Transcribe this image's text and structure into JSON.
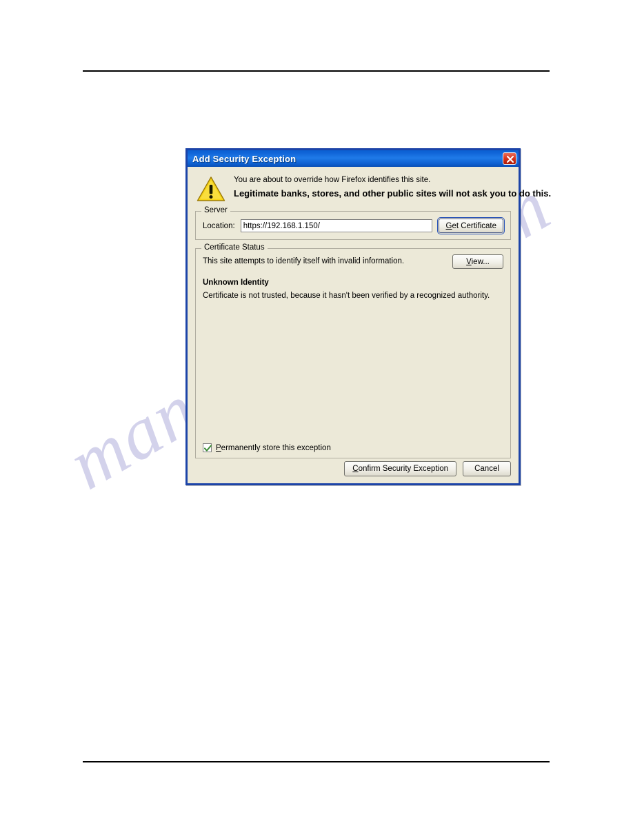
{
  "page": {
    "watermark_text": "manualshive.com",
    "watermark_color": "#b9b8e0",
    "rule_color": "#000000"
  },
  "dialog": {
    "title": "Add Security Exception",
    "titlebar_color": "#1f7ae8",
    "background_color": "#ece9d8",
    "border_color": "#1c44a8",
    "close_button": {
      "icon": "close-icon",
      "color": "#d8341d",
      "label": "Close"
    },
    "warning": {
      "icon": "warning-triangle-icon",
      "icon_color": "#f5cc18",
      "line1": "You are about to override how Firefox identifies this site.",
      "line2": "Legitimate banks, stores, and other public sites will not ask you to do this."
    },
    "server_group": {
      "title": "Server",
      "location_label": "Location:",
      "location_value": "https://192.168.1.150/",
      "location_placeholder": "",
      "get_certificate_button": {
        "prefix": "G",
        "rest": "et Certificate",
        "label": "Get Certificate",
        "focused": true
      }
    },
    "certificate_status_group": {
      "title": "Certificate Status",
      "status_line": "This site attempts to identify itself with invalid information.",
      "view_button": {
        "prefix": "V",
        "rest": "iew...",
        "label": "View..."
      },
      "subheading": "Unknown Identity",
      "detail": "Certificate is not trusted, because it hasn't been verified by a recognized authority.",
      "permanent_checkbox": {
        "checked": true,
        "check_color": "#3a8a34",
        "prefix": "P",
        "rest": "ermanently store this exception",
        "label": "Permanently store this exception"
      }
    },
    "footer": {
      "confirm_button": {
        "prefix": "C",
        "rest": "onfirm Security Exception",
        "label": "Confirm Security Exception"
      },
      "cancel_button": {
        "label": "Cancel"
      }
    }
  }
}
